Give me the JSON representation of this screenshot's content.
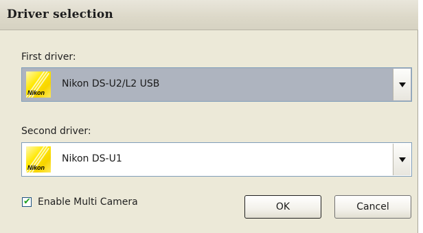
{
  "window": {
    "title": "Driver selection"
  },
  "first_driver": {
    "label": "First driver:",
    "selected": "Nikon DS-U2/L2 USB",
    "logo_text": "Nikon",
    "icon": "nikon-logo-icon"
  },
  "second_driver": {
    "label": "Second driver:",
    "selected": "Nikon DS-U1",
    "logo_text": "Nikon",
    "icon": "nikon-logo-icon"
  },
  "multi_camera": {
    "label": "Enable Multi Camera",
    "checked": true,
    "checkmark": "✔"
  },
  "buttons": {
    "ok": "OK",
    "cancel": "Cancel"
  },
  "colors": {
    "dialog_bg": "#ece9d8",
    "selected_combo_bg": "#aeb4bf",
    "logo_yellow": "#ffe800",
    "combo_border": "#7f9db9"
  }
}
